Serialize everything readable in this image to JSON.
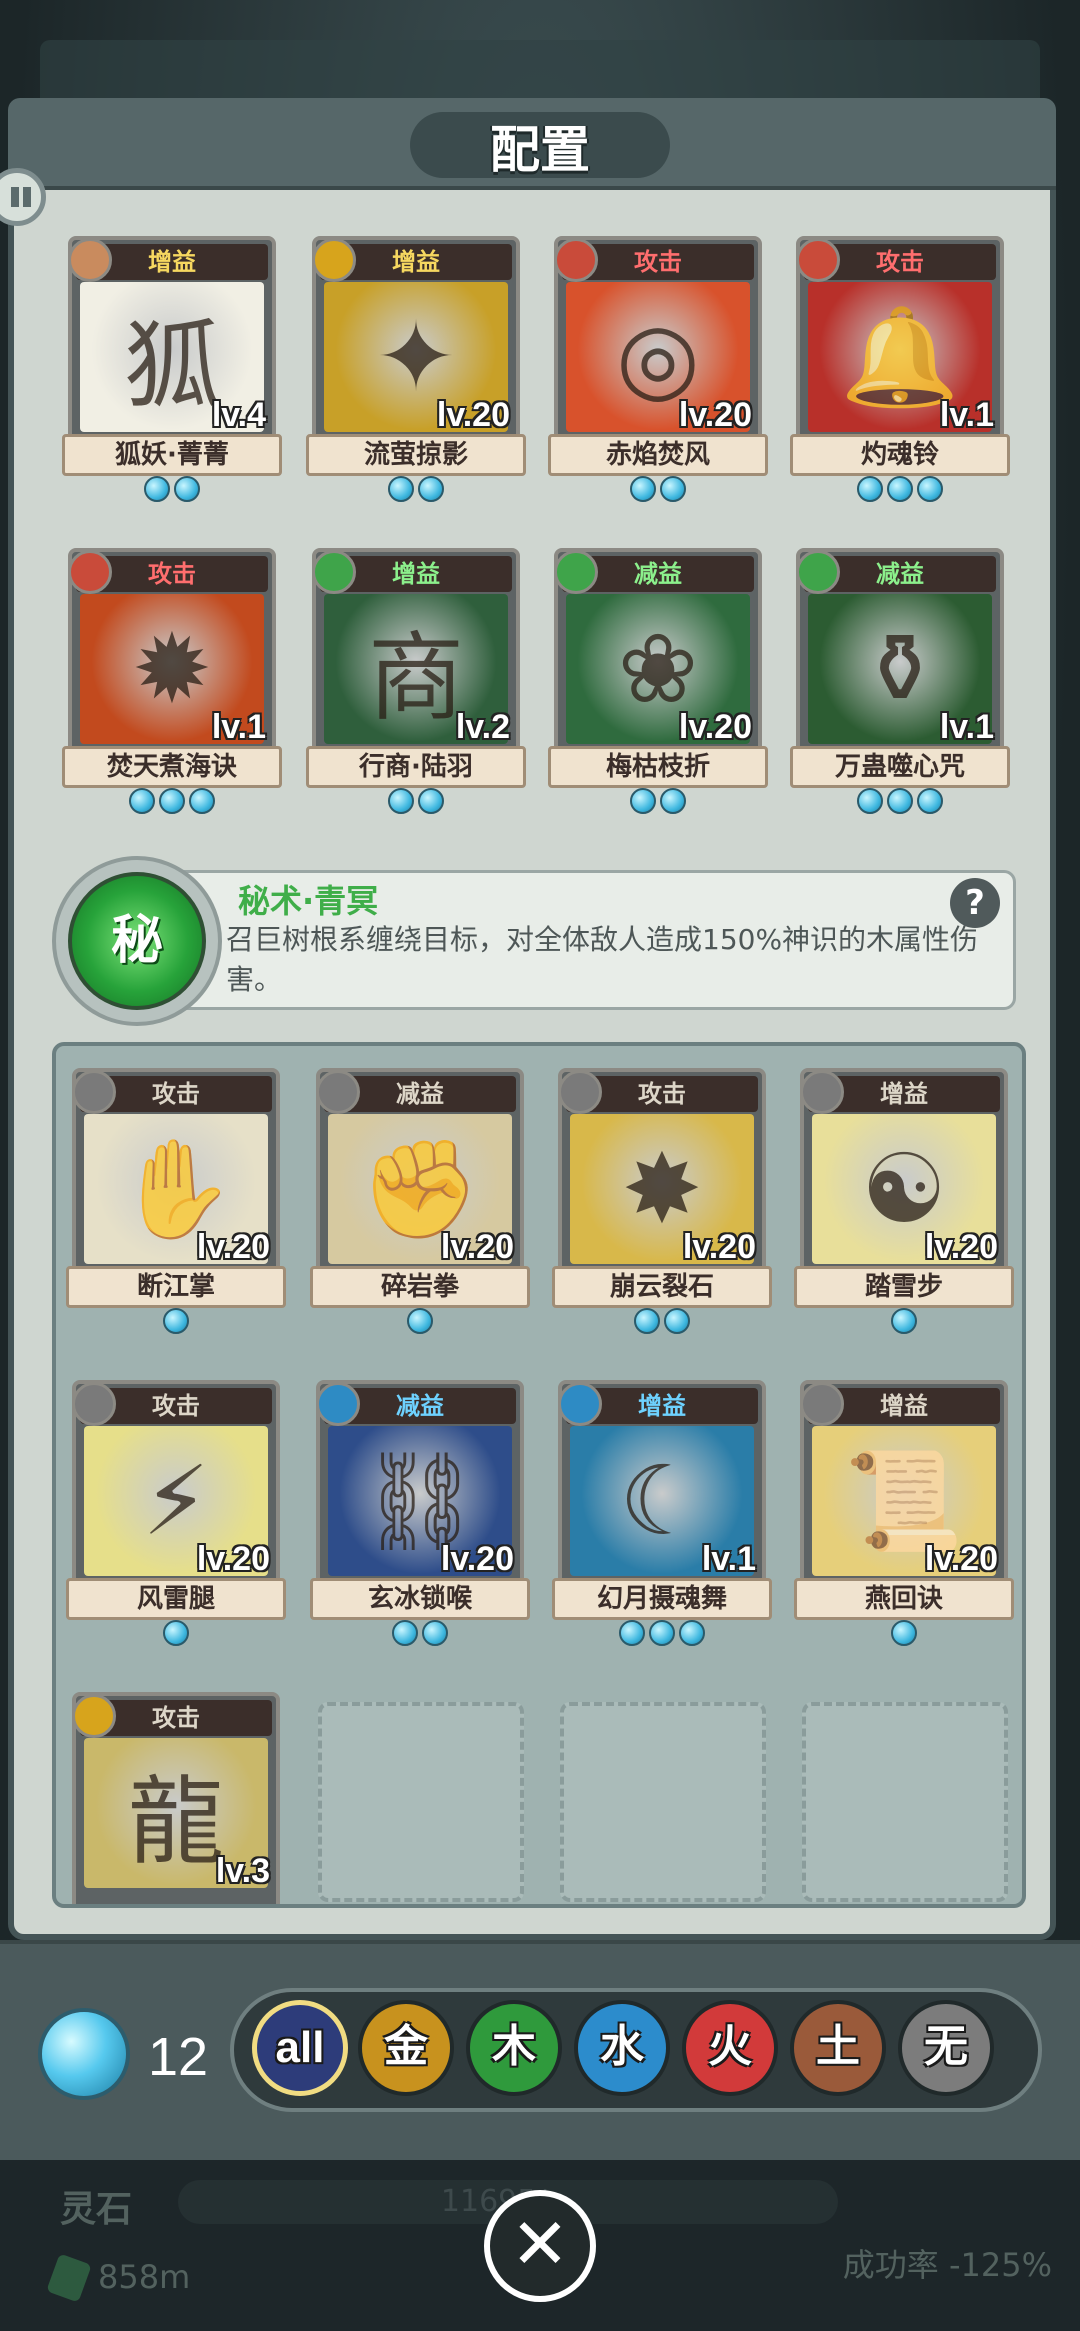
{
  "panel_title": "配置",
  "equipped": [
    {
      "type": "增益",
      "type_class": "buff",
      "icon_color": "#c98b5e",
      "name": "狐妖·菁菁",
      "level": "lv.4",
      "gems": 2,
      "art": "#f1efe4",
      "glyph": "狐"
    },
    {
      "type": "增益",
      "type_class": "buff",
      "icon_color": "#d7a41c",
      "name": "流萤掠影",
      "level": "lv.20",
      "gems": 2,
      "art": "#c8a028",
      "glyph": "✦"
    },
    {
      "type": "攻击",
      "type_class": "attack",
      "icon_color": "#c94b3a",
      "name": "赤焰焚风",
      "level": "lv.20",
      "gems": 2,
      "art": "#d8522c",
      "glyph": "◎"
    },
    {
      "type": "攻击",
      "type_class": "attack",
      "icon_color": "#c94b3a",
      "name": "灼魂铃",
      "level": "lv.1",
      "gems": 3,
      "art": "#b8302a",
      "glyph": "🔔"
    },
    {
      "type": "攻击",
      "type_class": "attack",
      "icon_color": "#c94b3a",
      "name": "焚天煮海诀",
      "level": "lv.1",
      "gems": 3,
      "art": "#c24a1e",
      "glyph": "✹"
    },
    {
      "type": "增益",
      "type_class": "debuff",
      "icon_color": "#3fa44a",
      "name": "行商·陆羽",
      "level": "lv.2",
      "gems": 2,
      "art": "#2f5f3c",
      "glyph": "商"
    },
    {
      "type": "减益",
      "type_class": "debuff",
      "icon_color": "#3fa44a",
      "name": "梅枯枝折",
      "level": "lv.20",
      "gems": 2,
      "art": "#2f6b3e",
      "glyph": "❀"
    },
    {
      "type": "减益",
      "type_class": "debuff",
      "icon_color": "#3fa44a",
      "name": "万蛊噬心咒",
      "level": "lv.1",
      "gems": 3,
      "art": "#2c5c32",
      "glyph": "⚱"
    }
  ],
  "skill": {
    "badge": "秘",
    "name": "秘术·青冥",
    "description": "召巨树根系缠绕目标，对全体敌人造成150%神识的木属性伤害。",
    "help": "?"
  },
  "inventory": [
    {
      "type": "攻击",
      "type_class": "grey",
      "icon_color": "#7a7a7a",
      "name": "断江掌",
      "level": "lv.20",
      "gems": 1,
      "art": "#e6e0c8",
      "glyph": "✋"
    },
    {
      "type": "减益",
      "type_class": "grey",
      "icon_color": "#7a7a7a",
      "name": "碎岩拳",
      "level": "lv.20",
      "gems": 1,
      "art": "#d6c9a0",
      "glyph": "✊"
    },
    {
      "type": "攻击",
      "type_class": "grey",
      "icon_color": "#7a7a7a",
      "name": "崩云裂石",
      "level": "lv.20",
      "gems": 2,
      "art": "#d8b84a",
      "glyph": "✸"
    },
    {
      "type": "增益",
      "type_class": "grey",
      "icon_color": "#7a7a7a",
      "name": "踏雪步",
      "level": "lv.20",
      "gems": 1,
      "art": "#e8df9a",
      "glyph": "☯"
    },
    {
      "type": "攻击",
      "type_class": "grey",
      "icon_color": "#7a7a7a",
      "name": "风雷腿",
      "level": "lv.20",
      "gems": 1,
      "art": "#e6df8a",
      "glyph": "⚡"
    },
    {
      "type": "减益",
      "type_class": "buff-blue",
      "icon_color": "#2e8bc4",
      "name": "玄冰锁喉",
      "level": "lv.20",
      "gems": 2,
      "art": "#2e4d8a",
      "glyph": "⛓"
    },
    {
      "type": "增益",
      "type_class": "buff-blue",
      "icon_color": "#2e8bc4",
      "name": "幻月摄魂舞",
      "level": "lv.1",
      "gems": 3,
      "art": "#2a7da8",
      "glyph": "☾"
    },
    {
      "type": "增益",
      "type_class": "grey",
      "icon_color": "#7a7a7a",
      "name": "燕回诀",
      "level": "lv.20",
      "gems": 1,
      "art": "#e6cf7a",
      "glyph": "📜"
    },
    {
      "type": "攻击",
      "type_class": "grey",
      "icon_color": "#d7a41c",
      "name": "",
      "level": "lv.3",
      "gems": 0,
      "art": "#c9b86a",
      "glyph": "龍"
    }
  ],
  "orb_count": "12",
  "filters": [
    {
      "label": "all",
      "color": "#2d3c7a"
    },
    {
      "label": "金",
      "color": "#c8921e"
    },
    {
      "label": "木",
      "color": "#2f9a3c"
    },
    {
      "label": "水",
      "color": "#2c8ccc"
    },
    {
      "label": "火",
      "color": "#d23a3a"
    },
    {
      "label": "土",
      "color": "#9a5a3a"
    },
    {
      "label": "无",
      "color": "#7c7c7c"
    }
  ],
  "background": {
    "stone_label": "灵石",
    "stone_amount": "858m",
    "progress_text": "11695/...",
    "success_rate": "成功率 -125%"
  },
  "close_symbol": "✕"
}
